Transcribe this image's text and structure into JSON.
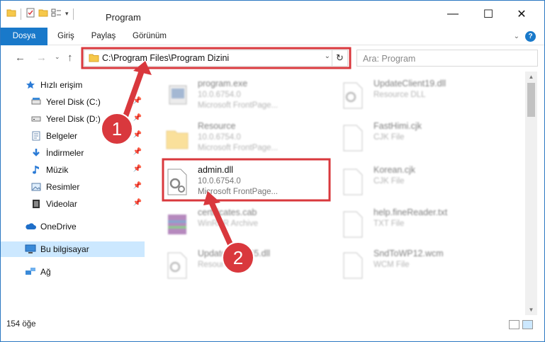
{
  "window": {
    "title": "Program",
    "controls": {
      "minimize": "—",
      "maximize": "☐",
      "close": "✕"
    }
  },
  "ribbon": {
    "tabs": [
      "Dosya",
      "Giriş",
      "Paylaş",
      "Görünüm"
    ],
    "help": "?"
  },
  "address_bar": {
    "path": "C:\\Program Files\\Program Dizini",
    "refresh": "↻",
    "dropdown": "⌄"
  },
  "search": {
    "placeholder": "Ara: Program"
  },
  "sidebar": {
    "items": [
      {
        "label": "Hızlı erişim",
        "icon": "star-icon",
        "pinned": false
      },
      {
        "label": "Yerel Disk (C:)",
        "icon": "drive-icon",
        "pinned": true
      },
      {
        "label": "Yerel Disk (D:)",
        "icon": "drive-icon",
        "pinned": true
      },
      {
        "label": "Belgeler",
        "icon": "documents-icon",
        "pinned": true
      },
      {
        "label": "İndirmeler",
        "icon": "download-icon",
        "pinned": true
      },
      {
        "label": "Müzik",
        "icon": "music-icon",
        "pinned": true
      },
      {
        "label": "Resimler",
        "icon": "pictures-icon",
        "pinned": true
      },
      {
        "label": "Videolar",
        "icon": "videos-icon",
        "pinned": true
      },
      {
        "label": "OneDrive",
        "icon": "cloud-icon",
        "pinned": false
      },
      {
        "label": "Bu bilgisayar",
        "icon": "computer-icon",
        "pinned": false,
        "selected": true
      },
      {
        "label": "Ağ",
        "icon": "network-icon",
        "pinned": false
      }
    ]
  },
  "files": {
    "left": [
      {
        "name": "program.exe",
        "line2": "10.0.6754.0",
        "line3": "Microsoft FrontPage...",
        "icon": "exe-icon"
      },
      {
        "name": "Resource",
        "line2": "10.0.6754.0",
        "line3": "Microsoft FrontPage...",
        "icon": "folder-icon"
      },
      {
        "name": "admin.dll",
        "line2": "10.0.6754.0",
        "line3": "Microsoft FrontPage...",
        "icon": "dll-icon",
        "highlighted": true
      },
      {
        "name": "certificates.cab",
        "line2": "WinRAR Archive",
        "line3": "",
        "icon": "archive-icon"
      },
      {
        "name": "UpdateClient65.dll",
        "line2": "Resource DLL",
        "line3": "",
        "icon": "dll-icon"
      }
    ],
    "right": [
      {
        "name": "UpdateClient19.dll",
        "line2": "Resource DLL",
        "icon": "dll-icon"
      },
      {
        "name": "FastHimi.cjk",
        "line2": "CJK File",
        "icon": "file-icon"
      },
      {
        "name": "Korean.cjk",
        "line2": "CJK File",
        "icon": "file-icon"
      },
      {
        "name": "help.fineReader.txt",
        "line2": "TXT File",
        "icon": "file-icon"
      },
      {
        "name": "SndToWP12.wcm",
        "line2": "WCM File",
        "icon": "file-icon"
      }
    ]
  },
  "status": {
    "count": "154 öğe"
  },
  "annotations": {
    "step1": "1",
    "step2": "2"
  },
  "colors": {
    "accent": "#1979ca",
    "annotation_red": "#d9383d",
    "selected": "#cce8ff"
  }
}
